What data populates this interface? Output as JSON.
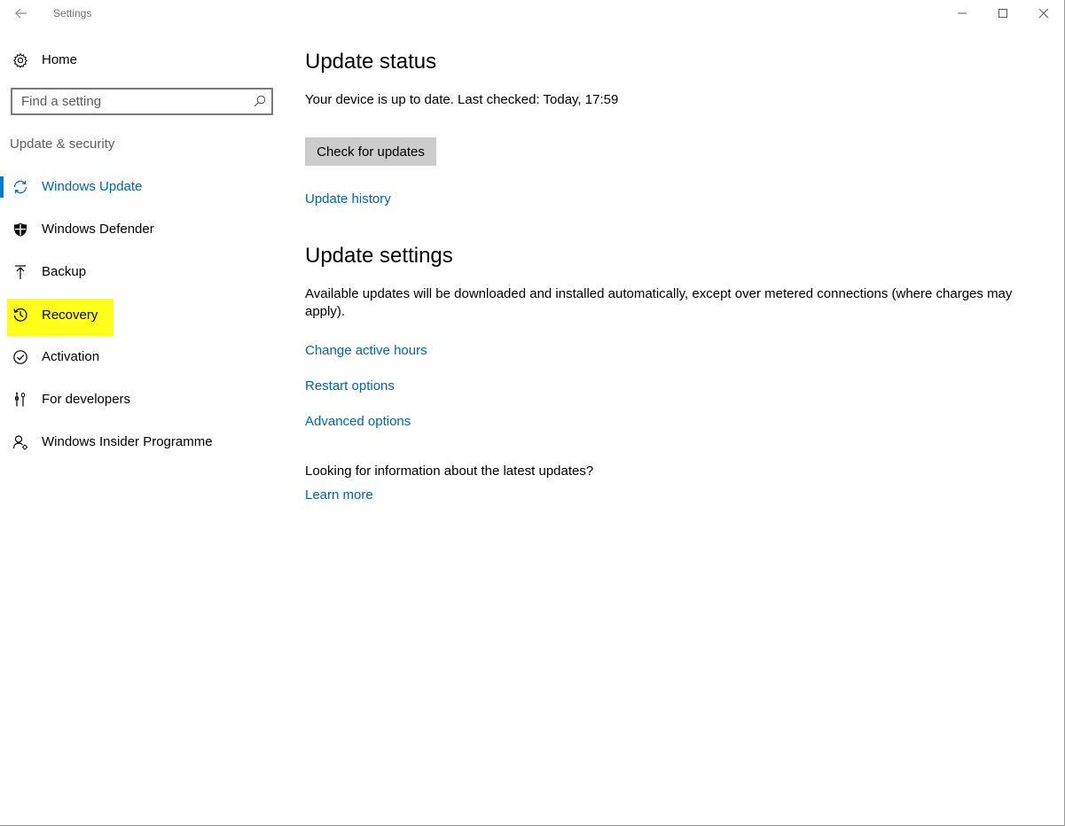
{
  "window": {
    "title": "Settings"
  },
  "sidebar": {
    "home_label": "Home",
    "search_placeholder": "Find a setting",
    "section_label": "Update & security",
    "items": [
      {
        "label": "Windows Update",
        "icon": "sync-icon",
        "active": true
      },
      {
        "label": "Windows Defender",
        "icon": "shield-icon"
      },
      {
        "label": "Backup",
        "icon": "backup-arrow-up-icon"
      },
      {
        "label": "Recovery",
        "icon": "history-clock-icon",
        "highlighted": true
      },
      {
        "label": "Activation",
        "icon": "checkmark-circle-icon"
      },
      {
        "label": "For developers",
        "icon": "developer-tools-icon"
      },
      {
        "label": "Windows Insider Programme",
        "icon": "insider-person-icon"
      }
    ]
  },
  "main": {
    "status_heading": "Update status",
    "status_text": "Your device is up to date. Last checked: Today, 17:59",
    "check_button": "Check for updates",
    "history_link": "Update history",
    "settings_heading": "Update settings",
    "settings_text": "Available updates will be downloaded and installed automatically, except over metered connections (where charges may apply).",
    "active_hours_link": "Change active hours",
    "restart_link": "Restart options",
    "advanced_link": "Advanced options",
    "info_text": "Looking for information about the latest updates?",
    "learn_more_link": "Learn more"
  },
  "colors": {
    "accent": "#0078d7",
    "link": "#0063b1",
    "highlight": "#ffff1a",
    "button_bg": "#cccccc"
  }
}
